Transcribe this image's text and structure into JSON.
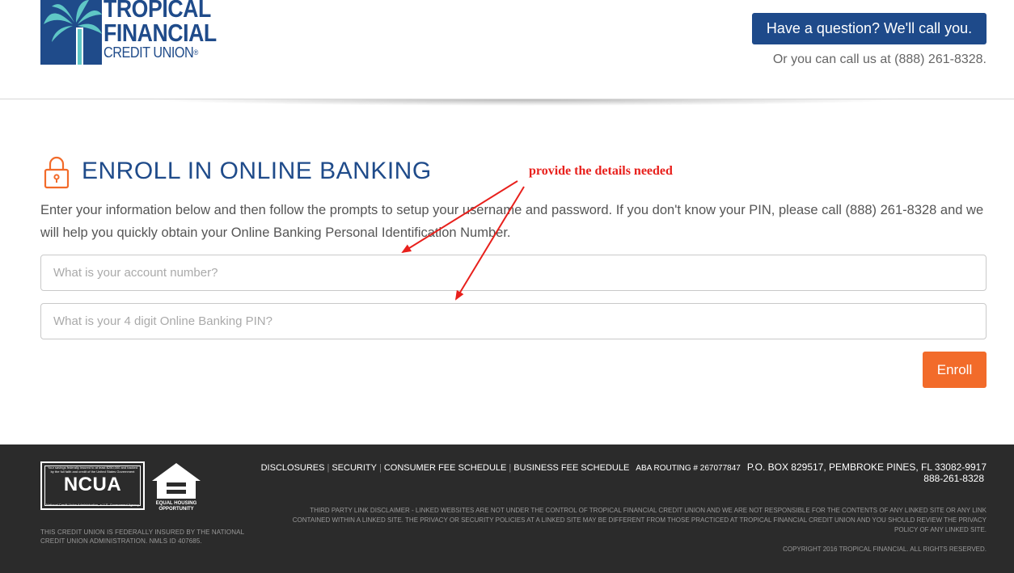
{
  "header": {
    "logo": {
      "line1": "TROPICAL",
      "line2": "FINANCIAL",
      "line3": "CREDIT UNION",
      "reg": "®"
    },
    "call_button_label": "Have a question? We'll call you.",
    "call_text": "Or you can call us at (888) 261-8328."
  },
  "main": {
    "title": "ENROLL IN ONLINE BANKING",
    "intro": "Enter your information below and then follow the prompts to setup your username and password. If you don't know your PIN, please call (888) 261-8328 and we will help you quickly obtain your Online Banking Personal Identification Number.",
    "account_placeholder": "What is your account number?",
    "pin_placeholder": "What is your 4 digit Online Banking PIN?",
    "enroll_label": "Enroll"
  },
  "annotation": {
    "text": "provide the details needed",
    "color": "#e8201c"
  },
  "footer": {
    "ncua_small": "Your savings federally insured to at least $250,000 and backed by the full faith and credit of the United States Government",
    "ncua_word": "NCUA",
    "ncua_foot": "National Credit Union Administration, a U.S. Government Agency",
    "eho_label": "EQUAL HOUSING OPPORTUNITY",
    "fed_text": "THIS CREDIT UNION IS FEDERALLY INSURED BY THE NATIONAL CREDIT UNION ADMINISTRATION. NMLS ID 407685.",
    "links": {
      "disclosures": "DISCLOSURES",
      "security": "SECURITY",
      "fees": "CONSUMER FEE SCHEDULE",
      "business_fees": "BUSINESS FEE SCHEDULE",
      "sep": "|",
      "routing": "ABA ROUTING # 267077847",
      "address": "P.O. BOX 829517, PEMBROKE PINES, FL 33082-9917"
    },
    "phone": "888-261-8328",
    "disclaimer": "THIRD PARTY LINK DISCLAIMER - LINKED WEBSITES ARE NOT UNDER THE CONTROL OF TROPICAL FINANCIAL CREDIT UNION AND WE ARE NOT RESPONSIBLE FOR THE CONTENTS OF ANY LINKED SITE OR ANY LINK CONTAINED WITHIN A LINKED SITE. THE PRIVACY OR SECURITY POLICIES AT A LINKED SITE MAY BE DIFFERENT FROM THOSE PRACTICED AT TROPICAL FINANCIAL CREDIT UNION AND YOU SHOULD REVIEW THE PRIVACY POLICY OF ANY LINKED SITE.",
    "copyright": "COPYRIGHT 2016 TROPICAL FINANCIAL. ALL RIGHTS RESERVED."
  },
  "colors": {
    "brand_blue": "#1f4b8a",
    "accent_orange": "#f26b2a",
    "footer_bg": "#2b2b2b"
  }
}
